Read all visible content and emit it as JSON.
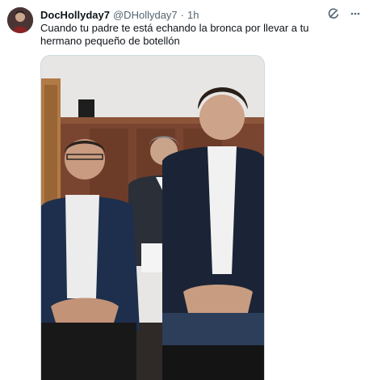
{
  "tweet": {
    "display_name": "DocHollyday7",
    "handle": "@DHollyday7",
    "separator": "·",
    "time": "1h",
    "text": "Cuando tu padre te está echando la bronca por llevar a tu hermano pequeño de botellón"
  },
  "icons": {
    "grok": "grok-icon",
    "more": "more-icon"
  },
  "media": {
    "description_icon": "photo"
  }
}
